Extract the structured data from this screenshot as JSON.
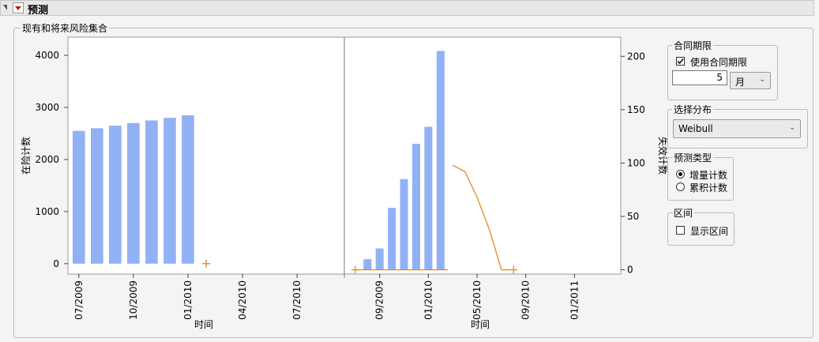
{
  "header": {
    "title": "预测"
  },
  "outline": {
    "title": "现有和将来风险集合"
  },
  "chart_data": [
    {
      "type": "bar",
      "ylabel": "在险计数",
      "xlabel": "时间",
      "ylim": [
        -200,
        4350
      ],
      "yticks": [
        0,
        1000,
        2000,
        3000,
        4000
      ],
      "xtick_labels": [
        "07/2009",
        "10/2009",
        "01/2010",
        "04/2010",
        "07/2010"
      ],
      "xtick_months": [
        0,
        3,
        6,
        9,
        12
      ],
      "xlim_months": [
        -0.6,
        14.6
      ],
      "bar_width_months": 0.68,
      "bar_color": "#92b1f5",
      "bars": [
        {
          "month": 0,
          "value": 2550
        },
        {
          "month": 1,
          "value": 2600
        },
        {
          "month": 2,
          "value": 2650
        },
        {
          "month": 3,
          "value": 2700
        },
        {
          "month": 4,
          "value": 2750
        },
        {
          "month": 5,
          "value": 2800
        },
        {
          "month": 6,
          "value": 2850
        }
      ],
      "forecast_points": [
        {
          "month": 7,
          "value": 0
        }
      ],
      "forecast_color": "#e08a28"
    },
    {
      "type": "bar",
      "ylabel": "失效计数",
      "xlabel": "时间",
      "ylim": [
        -4,
        218
      ],
      "yticks": [
        0,
        50,
        100,
        150,
        200
      ],
      "xtick_labels": [
        "09/2009",
        "01/2010",
        "05/2010",
        "09/2010",
        "01/2011"
      ],
      "xtick_months": [
        2,
        6,
        10,
        14,
        18
      ],
      "xlim_months": [
        -0.9,
        21.8
      ],
      "bar_width_months": 0.65,
      "bar_color": "#92b1f5",
      "bars": [
        {
          "month": 0,
          "value": 0
        },
        {
          "month": 1,
          "value": 10
        },
        {
          "month": 2,
          "value": 20
        },
        {
          "month": 3,
          "value": 58
        },
        {
          "month": 4,
          "value": 85
        },
        {
          "month": 5,
          "value": 118
        },
        {
          "month": 6,
          "value": 134
        },
        {
          "month": 7,
          "value": 205
        }
      ],
      "observed_line": [
        {
          "month": 0,
          "value": 0
        },
        {
          "month": 7.6,
          "value": 0
        }
      ],
      "forecast_line": [
        {
          "month": 8,
          "value": 98
        },
        {
          "month": 9,
          "value": 92
        },
        {
          "month": 10,
          "value": 68
        },
        {
          "month": 11,
          "value": 38
        },
        {
          "month": 12,
          "value": 0
        },
        {
          "month": 13,
          "value": 0
        }
      ],
      "forecast_color": "#e08a28"
    }
  ],
  "panel": {
    "contract": {
      "title": "合同期限",
      "use_label": "使用合同期限",
      "checked": true,
      "value": "5",
      "unit": "月"
    },
    "distribution": {
      "title": "选择分布",
      "value": "Weibull"
    },
    "forecast_type": {
      "title": "预测类型",
      "options": [
        "增量计数",
        "累积计数"
      ],
      "selected": 0
    },
    "interval": {
      "title": "区间",
      "show_label": "显示区间",
      "checked": false
    }
  }
}
